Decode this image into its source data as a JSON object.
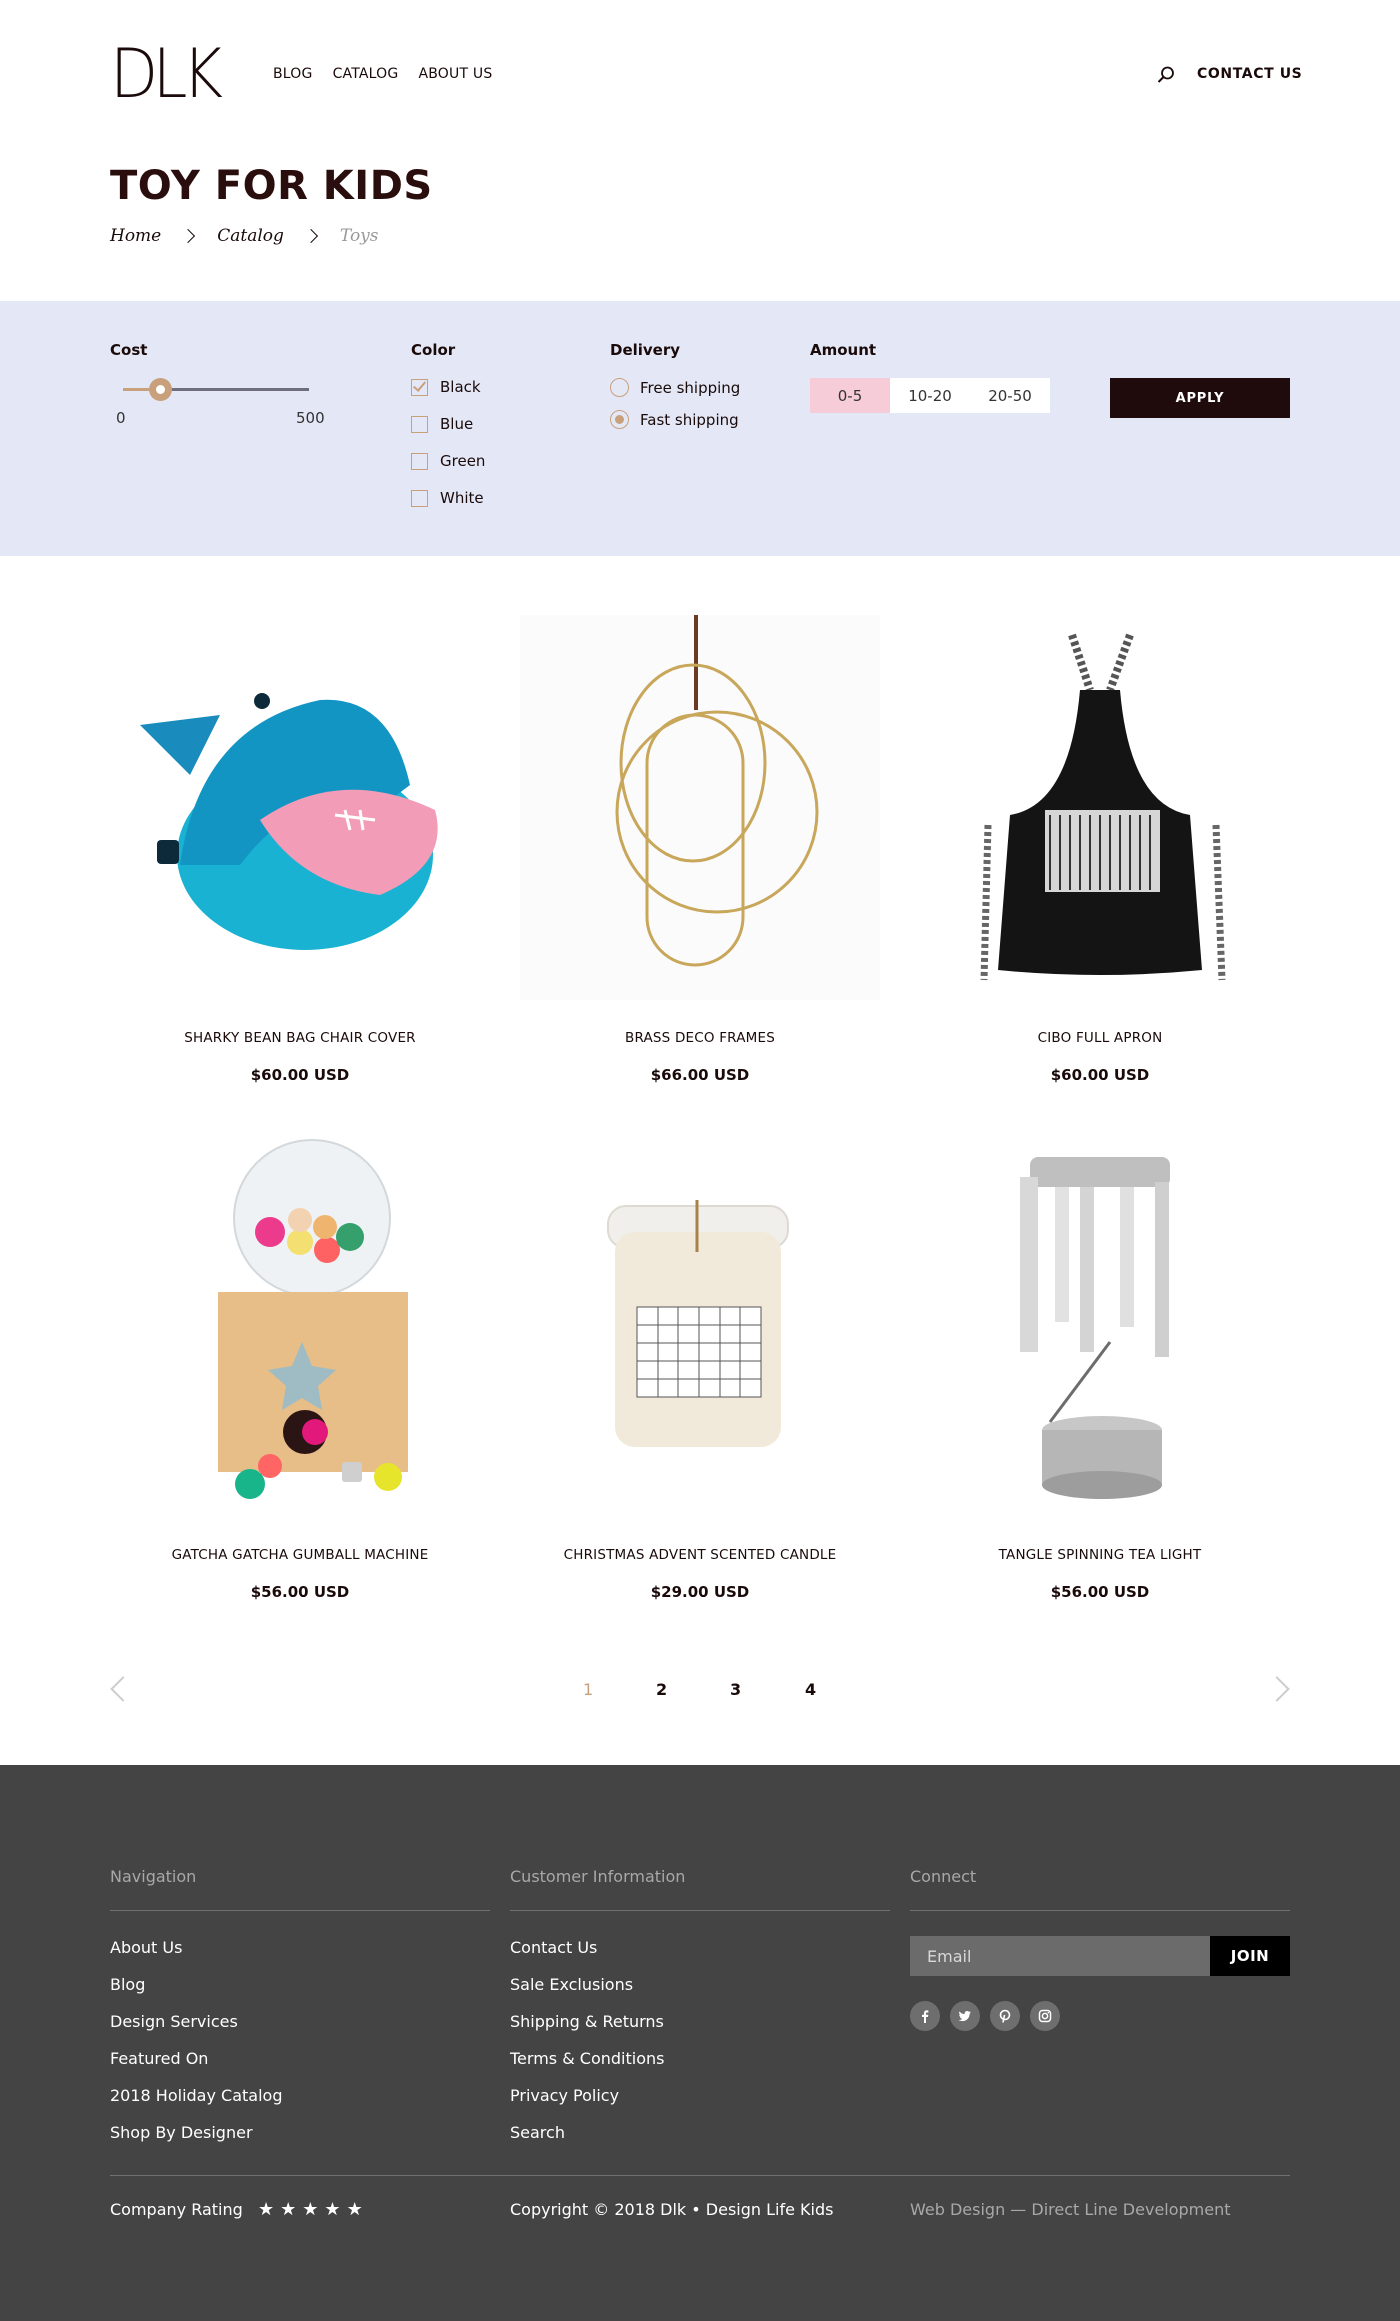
{
  "header": {
    "logo": "DLK",
    "nav": [
      "BLOG",
      "CATALOG",
      "ABOUT US"
    ],
    "contact": "CONTACT US"
  },
  "page": {
    "title": "TOY FOR KIDS",
    "breadcrumb": [
      "Home",
      "Catalog",
      "Toys"
    ]
  },
  "filters": {
    "cost": {
      "label": "Cost",
      "min": "0",
      "max": "500",
      "value_fraction": 0.2
    },
    "color": {
      "label": "Color",
      "options": [
        {
          "label": "Black",
          "checked": true
        },
        {
          "label": "Blue",
          "checked": false
        },
        {
          "label": "Green",
          "checked": false
        },
        {
          "label": "White",
          "checked": false
        }
      ]
    },
    "delivery": {
      "label": "Delivery",
      "options": [
        {
          "label": "Free shipping",
          "selected": false
        },
        {
          "label": "Fast shipping",
          "selected": true
        }
      ]
    },
    "amount": {
      "label": "Amount",
      "options": [
        "0-5",
        "10-20",
        "20-50"
      ],
      "selected": "0-5"
    },
    "apply": "APPLY"
  },
  "products": [
    {
      "name": "SHARKY BEAN BAG CHAIR COVER",
      "price": "$60.00 USD",
      "image": "shark-bean-bag"
    },
    {
      "name": "BRASS DECO FRAMES",
      "price": "$66.00 USD",
      "image": "brass-frames"
    },
    {
      "name": "CIBO FULL APRON",
      "price": "$60.00 USD",
      "image": "apron"
    },
    {
      "name": "GATCHA GATCHA GUMBALL MACHINE",
      "price": "$56.00 USD",
      "image": "gumball-machine"
    },
    {
      "name": "CHRISTMAS ADVENT SCENTED CANDLE",
      "price": "$29.00 USD",
      "image": "advent-candle"
    },
    {
      "name": "TANGLE SPINNING TEA LIGHT",
      "price": "$56.00 USD",
      "image": "tea-light"
    }
  ],
  "pagination": {
    "pages": [
      "1",
      "2",
      "3",
      "4"
    ],
    "current": "1"
  },
  "footer": {
    "navigation": {
      "heading": "Navigation",
      "links": [
        "About Us",
        "Blog",
        "Design Services",
        "Featured On",
        "2018 Holiday Catalog",
        "Shop By Designer"
      ]
    },
    "customer": {
      "heading": "Customer Information",
      "links": [
        "Contact Us",
        "Sale Exclusions",
        "Shipping & Returns",
        "Terms & Conditions",
        "Privacy Policy",
        "Search"
      ]
    },
    "connect": {
      "heading": "Connect",
      "email_placeholder": "Email",
      "join": "JOIN",
      "social": [
        "facebook-icon",
        "twitter-icon",
        "pinterest-icon",
        "instagram-icon"
      ]
    },
    "rating_label": "Company Rating",
    "rating_stars": 5,
    "copyright": "Copyright © 2018 Dlk • Design Life Kids",
    "credit": "Web Design — Direct Line Development"
  },
  "colors": {
    "accent": "#c8a07c",
    "filter_bg": "#e4e8f6",
    "dark": "#1f0b0b",
    "footer_bg": "#444444",
    "amount_active": "#f6ccd8"
  }
}
